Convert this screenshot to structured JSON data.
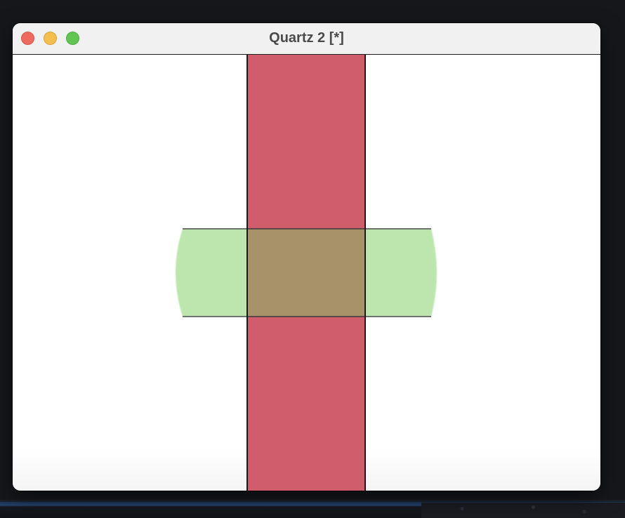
{
  "window": {
    "title": "Quartz 2 [*]",
    "buttons": {
      "close_icon": "close-icon",
      "minimize_icon": "minimize-icon",
      "zoom_icon": "zoom-icon"
    }
  },
  "canvas": {
    "vertical_bar_color": "#cf5d6c",
    "horizontal_band_color": "#bce6ae",
    "overlap_color": "#a8926a",
    "outline_color": "#1a1a1a"
  },
  "colors": {
    "titlebar": "#f1f1f1",
    "close": "#ec6a5e",
    "minimize": "#f5bf4f",
    "zoom": "#61c554"
  }
}
